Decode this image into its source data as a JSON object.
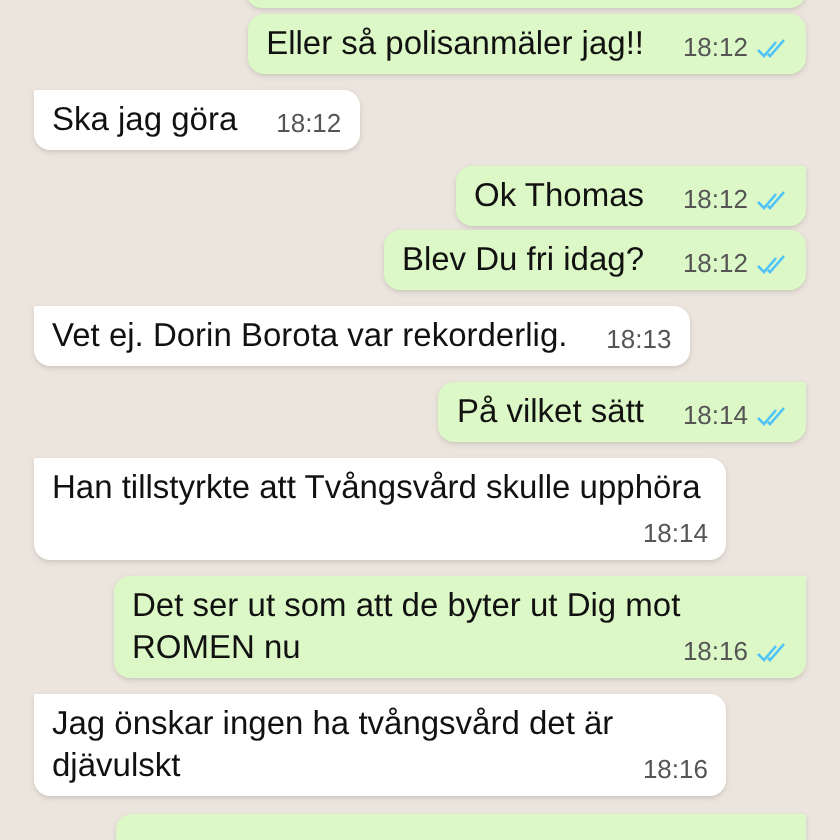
{
  "messages": [
    {
      "kind": "outgoing",
      "text": "Eller så polisanmäler jag!!",
      "time": "18:12",
      "read": true,
      "first": false
    },
    {
      "kind": "incoming",
      "text": "Ska jag göra",
      "time": "18:12",
      "first": true
    },
    {
      "kind": "outgoing",
      "text": "Ok Thomas",
      "time": "18:12",
      "read": true,
      "first": true
    },
    {
      "kind": "outgoing",
      "text": "Blev Du fri idag?",
      "time": "18:12",
      "read": true,
      "first": false
    },
    {
      "kind": "incoming",
      "text": "Vet ej. Dorin Borota var rekorderlig.",
      "time": "18:13",
      "first": true
    },
    {
      "kind": "outgoing",
      "text": "På vilket sätt",
      "time": "18:14",
      "read": true,
      "first": true
    },
    {
      "kind": "incoming",
      "text": "Han tillstyrkte att Tvångsvård skulle upphöra",
      "time": "18:14",
      "first": true
    },
    {
      "kind": "outgoing",
      "text": "Det ser ut som att de byter ut Dig mot ROMEN nu",
      "time": "18:16",
      "read": true,
      "first": true
    },
    {
      "kind": "incoming",
      "text": "Jag önskar ingen ha tvångsvård det är djävulskt",
      "time": "18:16",
      "first": true
    }
  ]
}
